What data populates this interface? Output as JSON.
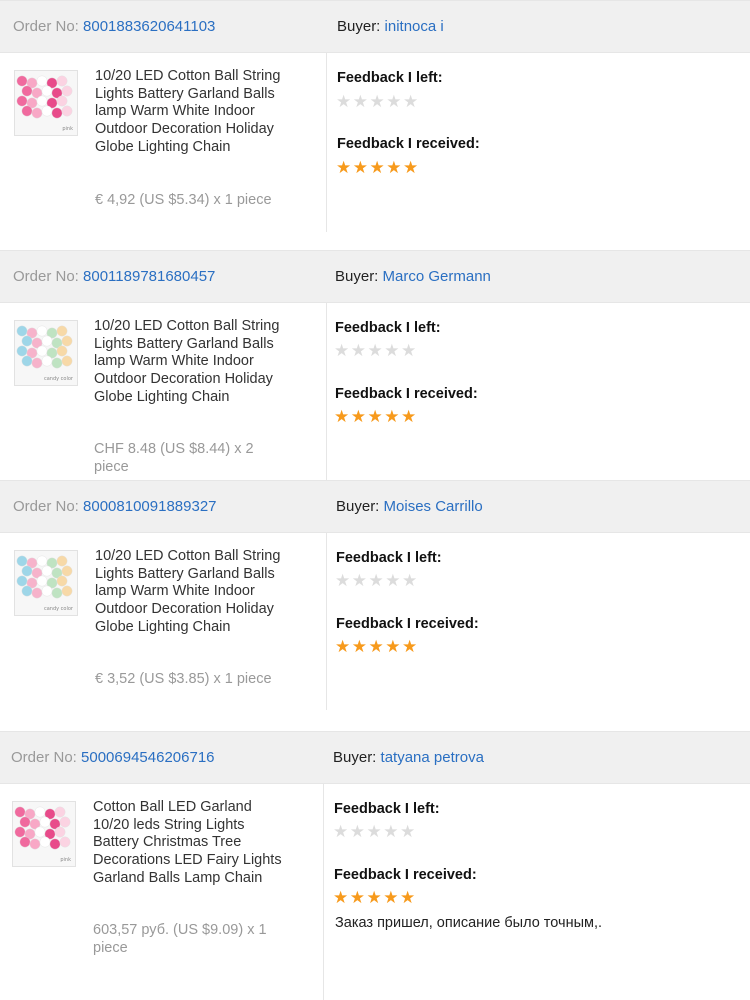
{
  "labels": {
    "order_no": "Order No:",
    "buyer": "Buyer:",
    "feedback_left": "Feedback I left:",
    "feedback_received": "Feedback I received:"
  },
  "orders": [
    {
      "order_number": "8001883620641103",
      "buyer_name": "initnoca i",
      "product_title": "10/20 LED Cotton Ball String Lights Battery Garland Balls lamp Warm White Indoor Outdoor Decoration Holiday Globe Lighting Chain",
      "price": "€ 4,92 (US $5.34) x 1 piece",
      "feedback_left_stars": 0,
      "feedback_received_stars": 5,
      "thumb_caption": "pink",
      "comment": ""
    },
    {
      "order_number": "8001189781680457",
      "buyer_name": "Marco Germann",
      "product_title": "10/20 LED Cotton Ball String Lights Battery Garland Balls lamp Warm White Indoor Outdoor Decoration Holiday Globe Lighting Chain",
      "price": "CHF 8.48 (US $8.44) x 2 piece",
      "feedback_left_stars": 0,
      "feedback_received_stars": 5,
      "thumb_caption": "candy color",
      "comment": ""
    },
    {
      "order_number": "8000810091889327",
      "buyer_name": "Moises Carrillo",
      "product_title": "10/20 LED Cotton Ball String Lights Battery Garland Balls lamp Warm White Indoor Outdoor Decoration Holiday Globe Lighting Chain",
      "price": "€ 3,52 (US $3.85) x 1 piece",
      "feedback_left_stars": 0,
      "feedback_received_stars": 5,
      "thumb_caption": "candy color",
      "comment": ""
    },
    {
      "order_number": "5000694546206716",
      "buyer_name": "tatyana petrova",
      "product_title": "Cotton Ball LED Garland 10/20 leds String Lights Battery Christmas Tree Decorations LED Fairy Lights Garland Balls Lamp Chain",
      "price": "603,57 руб. (US $9.09) x 1 piece",
      "feedback_left_stars": 0,
      "feedback_received_stars": 5,
      "thumb_caption": "pink",
      "comment": "Заказ пришел, описание было точным,."
    }
  ],
  "colors": {
    "link": "#2a6fc2",
    "star_full": "#f79a1c",
    "star_empty": "#dcdcdc",
    "header_bg": "#f0f0f0"
  },
  "icons": {
    "star_full": "star-filled-icon",
    "star_empty": "star-outline-icon"
  }
}
